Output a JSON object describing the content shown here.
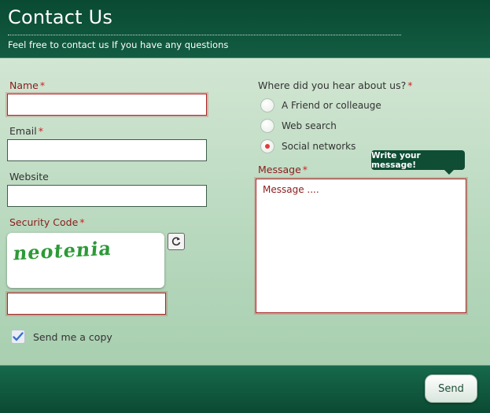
{
  "header": {
    "title": "Contact Us",
    "subtitle": "Feel free to contact us If you have any questions"
  },
  "form": {
    "name": {
      "label": "Name",
      "required_mark": "*",
      "value": ""
    },
    "email": {
      "label": "Email",
      "required_mark": "*",
      "value": ""
    },
    "website": {
      "label": "Website",
      "value": ""
    },
    "security": {
      "label": "Security Code",
      "required_mark": "*",
      "captcha_text": "neotenia",
      "value": ""
    },
    "copy": {
      "label": "Send me a copy",
      "checked": true
    },
    "source": {
      "question": "Where did you hear about us?",
      "required_mark": "*",
      "options": [
        "A Friend or colleauge",
        "Web search",
        "Social networks"
      ],
      "selected": "Social networks"
    },
    "message": {
      "label": "Message",
      "required_mark": "*",
      "placeholder": "Message ....",
      "value": ""
    },
    "tooltip": "Write your message!",
    "send_label": "Send"
  },
  "colors": {
    "header_bg": "#0a4a33",
    "panel_bg": "#c4e0c8",
    "error_border": "#a82727",
    "required": "#cc2222"
  },
  "icons": {
    "refresh": "refresh-icon",
    "check": "checkmark-icon"
  }
}
